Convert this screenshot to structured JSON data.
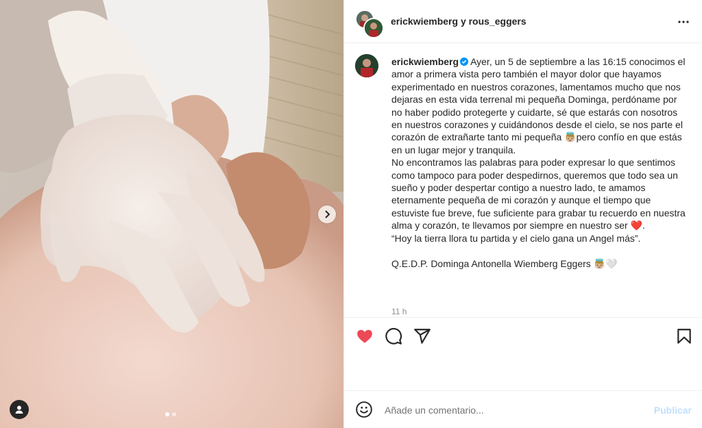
{
  "post": {
    "header_title": "erickwiemberg y rous_eggers",
    "caption_user": "erickwiemberg",
    "caption_text": "Ayer, un 5 de septiembre a las 16:15 conocimos el amor a primera vista pero también el mayor dolor que hayamos experimentado en nuestros corazones, lamentamos mucho que nos dejaras en esta vida terrenal mi pequeña Dominga, perdóname por no haber podido protegerte y cuidarte, sé que estarás con nosotros en nuestros corazones y cuidándonos desde el cielo, se nos parte el corazón de extrañarte tanto mi pequeña 👼🏼pero confío en que estás en un lugar mejor y tranquila.\nNo encontramos las palabras para poder expresar lo que sentimos como tampoco para poder despedirnos, queremos que todo sea un sueño y poder despertar contigo a nuestro lado, te amamos eternamente pequeña de mi corazón y aunque el tiempo que estuviste fue breve, fue suficiente para grabar tu recuerdo en nuestra alma y corazón, te llevamos por siempre en nuestro ser ❤️.\n“Hoy la tierra llora tu partida y el cielo gana un Angel más”.\n\nQ.E.D.P. Dominga Antonella Wiemberg Eggers 👼🏼🤍",
    "time_ago": "11 h"
  },
  "comment": {
    "placeholder": "Añade un comentario...",
    "post_label": "Publicar"
  },
  "colors": {
    "like_red": "#ed4956",
    "verified_blue": "#0095f6",
    "post_button_disabled": "#c0dffd"
  },
  "icons": [
    "next-arrow-icon",
    "tag-person-icon",
    "more-options-icon",
    "verified-badge-icon",
    "heart-filled-icon",
    "comment-icon",
    "share-icon",
    "bookmark-icon",
    "emoji-icon"
  ],
  "carousel": {
    "total": 2,
    "active": 1
  }
}
